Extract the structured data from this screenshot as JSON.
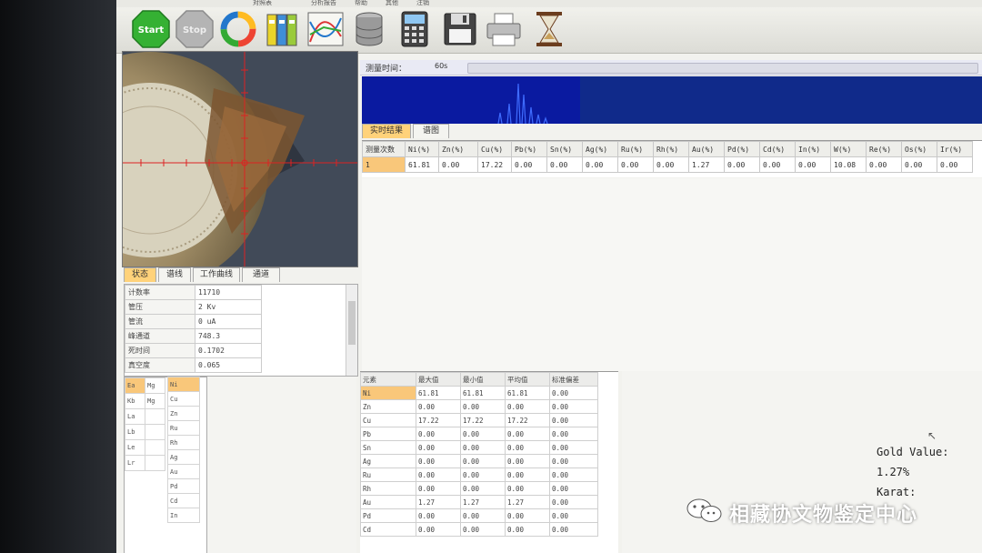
{
  "menu": [
    "对照表",
    "分析报告",
    "帮助",
    "其他",
    "注销"
  ],
  "toolbar": {
    "start_label": "Start",
    "stop_label": "Stop"
  },
  "measure_time": {
    "label": "测量时间：",
    "value": "60s"
  },
  "result_tabs": [
    "实时结果",
    "谱图"
  ],
  "results": {
    "columns": [
      "测量次数",
      "Ni(%)",
      "Zn(%)",
      "Cu(%)",
      "Pb(%)",
      "Sn(%)",
      "Ag(%)",
      "Ru(%)",
      "Rh(%)",
      "Au(%)",
      "Pd(%)",
      "Cd(%)",
      "In(%)",
      "W(%)",
      "Re(%)",
      "Os(%)",
      "Ir(%)"
    ],
    "row": [
      "1",
      "61.81",
      "0.00",
      "17.22",
      "0.00",
      "0.00",
      "0.00",
      "0.00",
      "0.00",
      "1.27",
      "0.00",
      "0.00",
      "0.00",
      "10.08",
      "0.00",
      "0.00",
      "0.00"
    ]
  },
  "status_tabs": [
    "状态",
    "谱线",
    "工作曲线",
    "通道"
  ],
  "status": [
    {
      "key": "计数率",
      "value": "11710"
    },
    {
      "key": "管压",
      "value": "2 Kv"
    },
    {
      "key": "管流",
      "value": "0 uA"
    },
    {
      "key": "峰通道",
      "value": "748.3"
    },
    {
      "key": "死时间",
      "value": "0.1702"
    },
    {
      "key": "真空度",
      "value": "0.065"
    }
  ],
  "elements_col1": [
    "Ea",
    "Kb",
    "La",
    "Lb",
    "Le",
    "Lr"
  ],
  "elements_col2": [
    "Mg",
    "Mg"
  ],
  "elements_col3": [
    "Ni",
    "Cu",
    "Zn",
    "Ru",
    "Rh",
    "Ag",
    "Au",
    "Pd",
    "Cd",
    "In"
  ],
  "stats": {
    "columns": [
      "元素",
      "最大值",
      "最小值",
      "平均值",
      "标准偏差"
    ],
    "rows": [
      [
        "Ni",
        "61.81",
        "61.81",
        "61.81",
        "0.00"
      ],
      [
        "Zn",
        "0.00",
        "0.00",
        "0.00",
        "0.00"
      ],
      [
        "Cu",
        "17.22",
        "17.22",
        "17.22",
        "0.00"
      ],
      [
        "Pb",
        "0.00",
        "0.00",
        "0.00",
        "0.00"
      ],
      [
        "Sn",
        "0.00",
        "0.00",
        "0.00",
        "0.00"
      ],
      [
        "Ag",
        "0.00",
        "0.00",
        "0.00",
        "0.00"
      ],
      [
        "Ru",
        "0.00",
        "0.00",
        "0.00",
        "0.00"
      ],
      [
        "Rh",
        "0.00",
        "0.00",
        "0.00",
        "0.00"
      ],
      [
        "Au",
        "1.27",
        "1.27",
        "1.27",
        "0.00"
      ],
      [
        "Pd",
        "0.00",
        "0.00",
        "0.00",
        "0.00"
      ],
      [
        "Cd",
        "0.00",
        "0.00",
        "0.00",
        "0.00"
      ]
    ]
  },
  "gold_value": {
    "label": "Gold Value:",
    "value": "1.27%",
    "karat_label": "Karat:"
  },
  "watermark": "相藏协文物鉴定中心",
  "colors": {
    "selected": "#f9c77a",
    "spectrum_bg": "#0d1b70",
    "start": "#35b133",
    "stop": "#9a9a9a"
  }
}
